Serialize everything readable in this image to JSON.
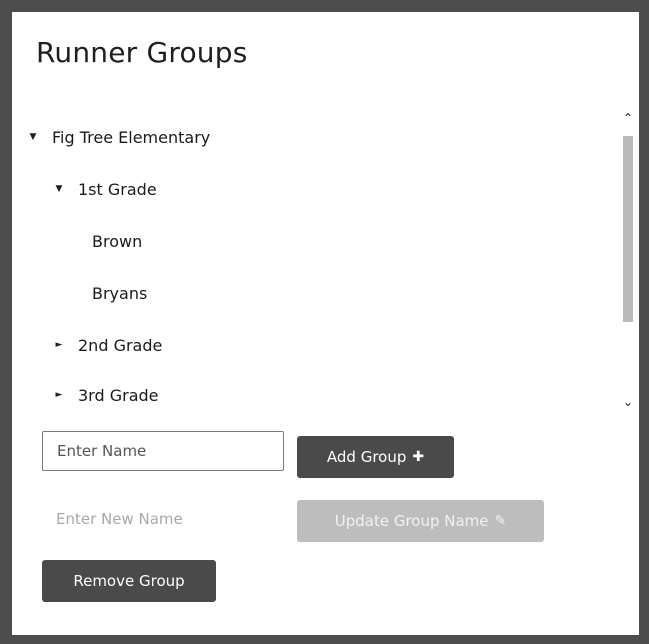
{
  "title": "Runner Groups",
  "tree": {
    "nodes": [
      {
        "label": "Fig Tree Elementary",
        "caret": "▼"
      },
      {
        "label": "1st Grade",
        "caret": "▼"
      },
      {
        "label": "Brown"
      },
      {
        "label": "Bryans"
      },
      {
        "label": "2nd Grade",
        "caret": "►"
      },
      {
        "label": "3rd Grade",
        "caret": "►"
      }
    ]
  },
  "scrollbar": {
    "up": "⌃",
    "down": "⌄"
  },
  "form": {
    "name_placeholder": "Enter Name",
    "add_label": "Add Group",
    "add_icon": "✚",
    "new_name_placeholder": "Enter New Name",
    "update_label": "Update Group Name",
    "update_icon": "✎",
    "remove_label": "Remove Group"
  }
}
